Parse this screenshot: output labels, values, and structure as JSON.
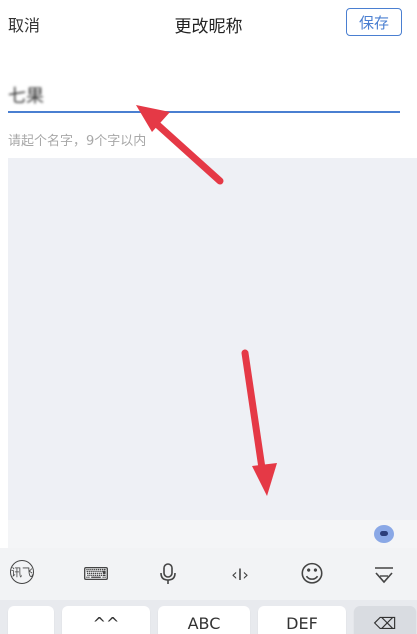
{
  "header": {
    "cancel_label": "取消",
    "title": "更改昵称",
    "save_label": "保存"
  },
  "form": {
    "current_value": "七果",
    "hint": "请起个名字，9个字以内"
  },
  "keyboard": {
    "toolbar": [
      {
        "name": "handwriting-switch-icon",
        "label": "讯飞"
      },
      {
        "name": "keyboard-icon",
        "label": "⌨"
      },
      {
        "name": "microphone-icon",
        "label": "🎤"
      },
      {
        "name": "cursor-move-icon",
        "label": "‹I›"
      },
      {
        "name": "emoji-icon",
        "label": "☺"
      },
      {
        "name": "collapse-keyboard-icon",
        "label": "▽"
      }
    ],
    "keys": [
      {
        "name": "key-blank-left",
        "label": ""
      },
      {
        "name": "key-ghi",
        "label": "^^"
      },
      {
        "name": "key-abc",
        "label": "ABC"
      },
      {
        "name": "key-def",
        "label": "DEF"
      },
      {
        "name": "key-delete",
        "label": "⌫"
      }
    ]
  },
  "colors": {
    "accent": "#4a7fd1",
    "panel_bg": "#eef0f5",
    "arrow": "#e53946"
  }
}
